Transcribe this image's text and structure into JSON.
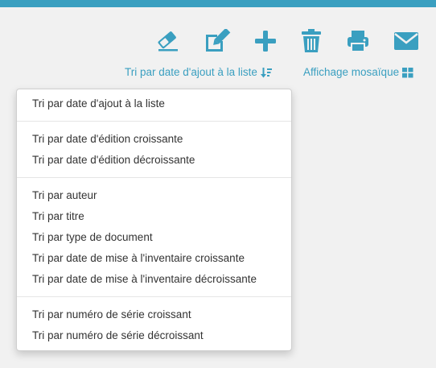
{
  "colors": {
    "accent": "#3a9fc0",
    "menu_text": "#333333",
    "background": "#f1f1f1"
  },
  "toolbar": {
    "icons": [
      "eraser-icon",
      "edit-icon",
      "plus-icon",
      "trash-icon",
      "print-icon",
      "envelope-icon"
    ]
  },
  "sort_controls": {
    "sort_label": "Tri par date d'ajout à la liste",
    "sort_icon": "sort-amount-down-icon",
    "view_label": "Affichage mosaïque",
    "view_icon": "grid-icon"
  },
  "dropdown": {
    "groups": [
      {
        "items": [
          "Tri par date d'ajout à la liste"
        ]
      },
      {
        "items": [
          "Tri par date d'édition croissante",
          "Tri par date d'édition décroissante"
        ]
      },
      {
        "items": [
          "Tri par auteur",
          "Tri par titre",
          "Tri par type de document",
          "Tri par date de mise à l'inventaire croissante",
          "Tri par date de mise à l'inventaire décroissante"
        ]
      },
      {
        "items": [
          "Tri par numéro de série croissant",
          "Tri par numéro de série décroissant"
        ]
      }
    ]
  }
}
